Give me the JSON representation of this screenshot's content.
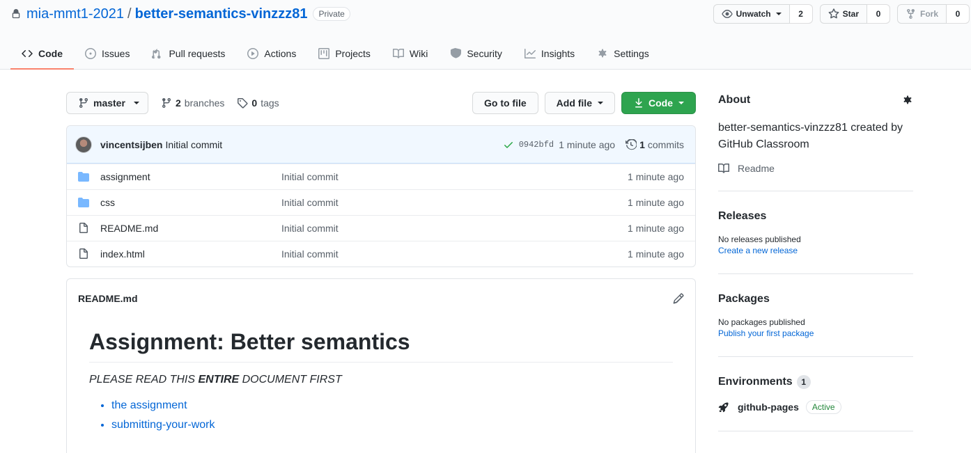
{
  "header": {
    "owner": "mia-mmt1-2021",
    "separator": "/",
    "repo": "better-semantics-vinzzz81",
    "visibility": "Private",
    "actions": {
      "watch_label": "Unwatch",
      "watch_count": "2",
      "star_label": "Star",
      "star_count": "0",
      "fork_label": "Fork",
      "fork_count": "0"
    }
  },
  "tabs": [
    {
      "label": "Code",
      "icon": "code-icon",
      "selected": true
    },
    {
      "label": "Issues",
      "icon": "issue-opened-icon"
    },
    {
      "label": "Pull requests",
      "icon": "git-pull-request-icon"
    },
    {
      "label": "Actions",
      "icon": "play-icon"
    },
    {
      "label": "Projects",
      "icon": "project-icon"
    },
    {
      "label": "Wiki",
      "icon": "book-icon"
    },
    {
      "label": "Security",
      "icon": "shield-icon"
    },
    {
      "label": "Insights",
      "icon": "graph-icon"
    },
    {
      "label": "Settings",
      "icon": "gear-icon"
    }
  ],
  "file_nav": {
    "branch": "master",
    "branches_count": "2",
    "branches_label": "branches",
    "tags_count": "0",
    "tags_label": "tags",
    "go_to_file": "Go to file",
    "add_file": "Add file",
    "code": "Code"
  },
  "commit": {
    "author": "vincentsijben",
    "message": "Initial commit",
    "sha": "0942bfd",
    "age": "1 minute ago",
    "count": "1",
    "count_label": "commits"
  },
  "files": [
    {
      "type": "dir",
      "name": "assignment",
      "message": "Initial commit",
      "age": "1 minute ago"
    },
    {
      "type": "dir",
      "name": "css",
      "message": "Initial commit",
      "age": "1 minute ago"
    },
    {
      "type": "file",
      "name": "README.md",
      "message": "Initial commit",
      "age": "1 minute ago"
    },
    {
      "type": "file",
      "name": "index.html",
      "message": "Initial commit",
      "age": "1 minute ago"
    }
  ],
  "readme": {
    "filename": "README.md",
    "heading": "Assignment: Better semantics",
    "intro_before": "PLEASE READ THIS ",
    "intro_bold": "ENTIRE",
    "intro_after": " DOCUMENT FIRST",
    "links": [
      "the assignment",
      "submitting-your-work"
    ]
  },
  "sidebar": {
    "about_title": "About",
    "about_desc": "better-semantics-vinzzz81 created by GitHub Classroom",
    "readme_link": "Readme",
    "releases_title": "Releases",
    "releases_empty": "No releases published",
    "releases_link": "Create a new release",
    "packages_title": "Packages",
    "packages_empty": "No packages published",
    "packages_link": "Publish your first package",
    "environments_title": "Environments",
    "environments_count": "1",
    "environment_name": "github-pages",
    "environment_status": "Active"
  },
  "colors": {
    "link": "#0366d6",
    "primary_button": "#2ea44f",
    "selected_tab_underline": "#f9826c",
    "commit_bar_bg": "#f1f8ff",
    "folder": "#79b8ff"
  }
}
